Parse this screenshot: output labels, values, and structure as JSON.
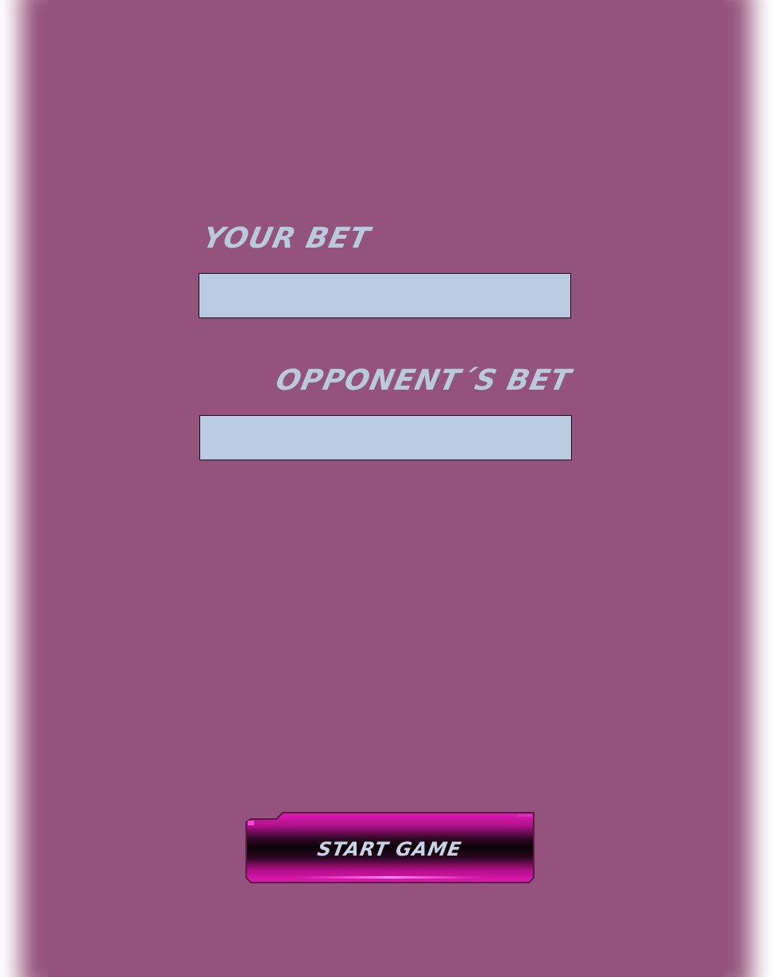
{
  "form": {
    "your_bet_label": "YOUR BET",
    "your_bet_value": "",
    "opponent_bet_label": "OPPONENT´S BET",
    "opponent_bet_value": ""
  },
  "actions": {
    "start_label": "START GAME"
  },
  "colors": {
    "background": "#94537c",
    "label_text": "#b9cadf",
    "input_fill": "#b9cbe0",
    "button_magenta": "#e010b0",
    "button_dark": "#140610"
  }
}
